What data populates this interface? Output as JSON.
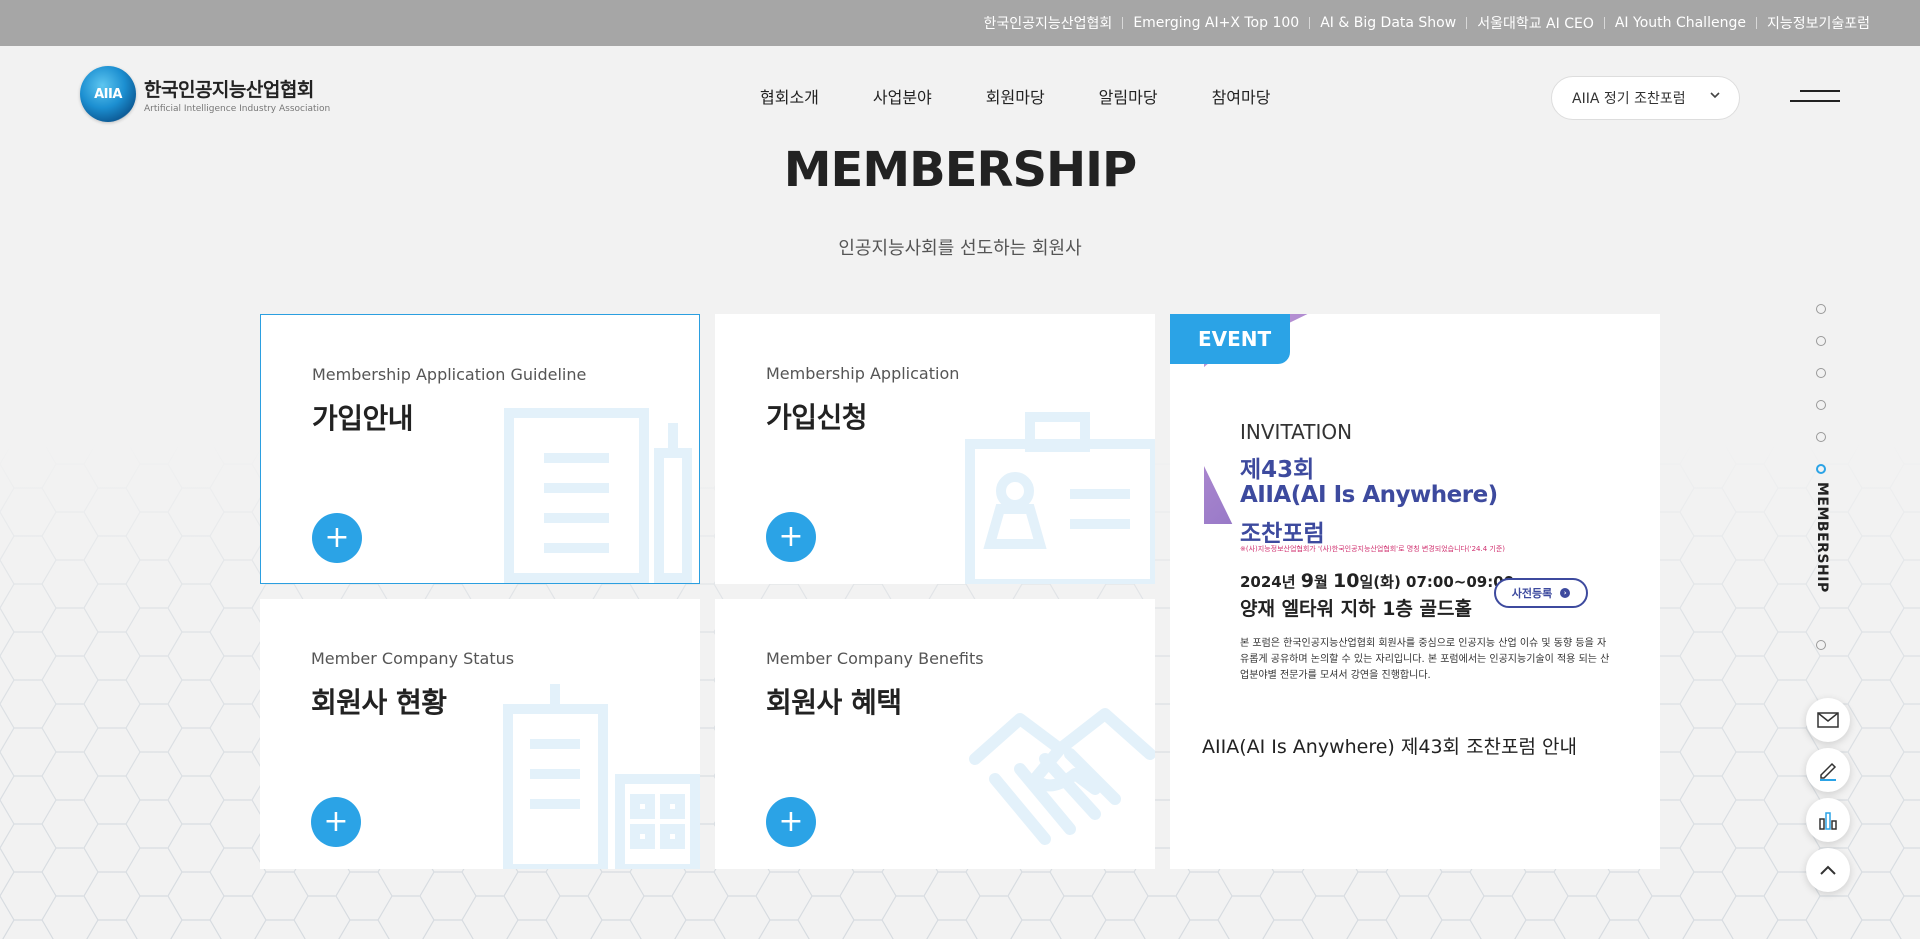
{
  "topbar": {
    "links": [
      "한국인공지능산업협회",
      "Emerging AI+X Top 100",
      "AI & Big Data Show",
      "서울대학교 AI CEO",
      "AI Youth Challenge",
      "지능정보기술포럼"
    ]
  },
  "logo": {
    "mark": "AIIA",
    "name_kr": "한국인공지능산업협회",
    "name_en": "Artificial Intelligence Industry Association"
  },
  "gnb": {
    "items": [
      "협회소개",
      "사업분야",
      "회원마당",
      "알림마당",
      "참여마당"
    ]
  },
  "forum_select": {
    "value": "AIIA 정기 조찬포럼"
  },
  "section": {
    "title": "MEMBERSHIP",
    "subtitle": "인공지능사회를 선도하는 회원사"
  },
  "cards": [
    {
      "en": "Membership Application Guideline",
      "kr": "가입안내",
      "icon": "document-building-icon"
    },
    {
      "en": "Membership Application",
      "kr": "가입신청",
      "icon": "id-card-icon"
    },
    {
      "en": "Member Company Status",
      "kr": "회원사 현황",
      "icon": "buildings-icon"
    },
    {
      "en": "Member Company Benefits",
      "kr": "회원사 혜택",
      "icon": "handshake-icon"
    }
  ],
  "plus_symbol": "+",
  "event": {
    "badge": "EVENT",
    "poster": {
      "invitation": "INVITATION",
      "title_line1": "제43회",
      "title_line2": "AIIA(AI Is Anywhere)",
      "title_line3": "조찬포럼",
      "note": "※(사)지능정보산업협회가 '(사)한국인공지능산업협회'로 명칭 변경되었습니다('24.4 기준)",
      "date_prefix": "2024년 ",
      "date_month": "9",
      "date_mid": "월 ",
      "date_day": "10",
      "date_suffix": "일(화) 07:00~09:00",
      "venue": "양재 엘타워 지하 1층 골드홀",
      "register": "사전등록",
      "description": "본 포럼은 한국인공지능산업협회 회원사를 중심으로 인공지능 산업 이슈 및 동향 등을 자유롭게 공유하며 논의할 수 있는 자리입니다. 본 포럼에서는 인공지능기술이 적용 되는 산업분야별 전문가를 모셔서 강연을 진행합니다."
    },
    "caption": "AIIA(AI Is Anywhere) 제43회 조찬포럼 안내"
  },
  "side_nav": {
    "label": "MEMBERSHIP",
    "active_index": 5,
    "count": 7
  },
  "colors": {
    "accent": "#2ba3e6",
    "topbar": "#a6a6a6",
    "poster_title": "#3d4a9e"
  },
  "floating": [
    "mail-icon",
    "pencil-icon",
    "chart-icon",
    "arrow-up-icon"
  ]
}
